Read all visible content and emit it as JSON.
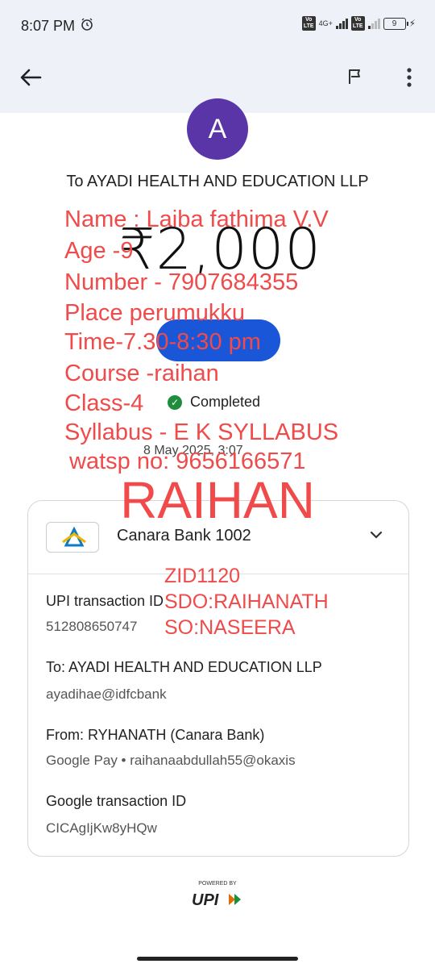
{
  "status_bar": {
    "time": "8:07 PM",
    "network": "4G+",
    "battery": "9"
  },
  "header": {
    "icons": [
      "back-arrow-icon",
      "flag-icon",
      "more-vert-icon"
    ]
  },
  "payee": {
    "avatar_letter": "A",
    "to_line": "To AYADI HEALTH AND EDUCATION LLP",
    "amount": "₹2,000",
    "status": "Completed",
    "date": "8 May 2025, 3:07"
  },
  "overlay": {
    "name": "Name : Laiba fathima V.V",
    "age": "Age -9",
    "number": "Number - 7907684355",
    "place": "Place perumukku",
    "time": "Time-7.30-8:30 pm",
    "course": "Course -raihan",
    "class": "Class-4",
    "syllabus": "Syllabus - E K SYLLABUS",
    "watsp": "watsp no: 9656166571",
    "big": "RAIHAN",
    "zid": "ZID1120",
    "sdo": "SDO:RAIHANATH",
    "so": "SO:NASEERA"
  },
  "card": {
    "bank": "Canara Bank 1002",
    "upi_label": "UPI transaction ID",
    "upi_id": "512808650747",
    "to_label": "To: AYADI HEALTH AND EDUCATION LLP",
    "to_vpa": "ayadihae@idfcbank",
    "from_label": "From: RYHANATH (Canara Bank)",
    "from_detail": "Google Pay • raihanaabdullah55@okaxis",
    "google_label": "Google transaction ID",
    "google_id": "CICAgIjKw8yHQw"
  },
  "footer": {
    "powered_by": "POWERED BY",
    "logo": "UPI"
  },
  "colors": {
    "accent": "#1a56d8",
    "overlay_red": "#f04a4a",
    "avatar": "#5a35a8",
    "success": "#1e8e3e"
  }
}
